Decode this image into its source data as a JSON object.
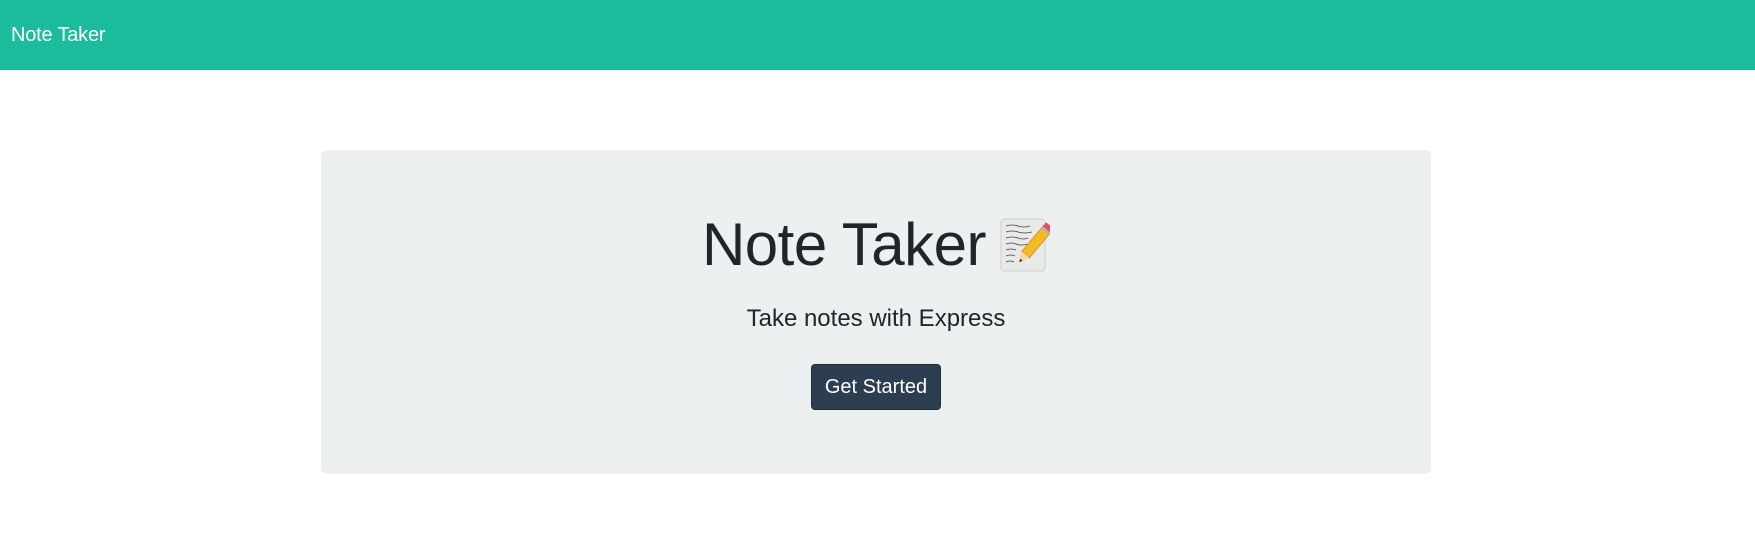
{
  "navbar": {
    "brand": "Note Taker"
  },
  "hero": {
    "title": "Note Taker",
    "title_icon": "memo-icon",
    "lead": "Take notes with Express",
    "cta_label": "Get Started"
  },
  "colors": {
    "navbar_bg": "#1abc9c",
    "jumbotron_bg": "#ecf0f1",
    "button_bg": "#2c3e50",
    "text": "#212529"
  }
}
